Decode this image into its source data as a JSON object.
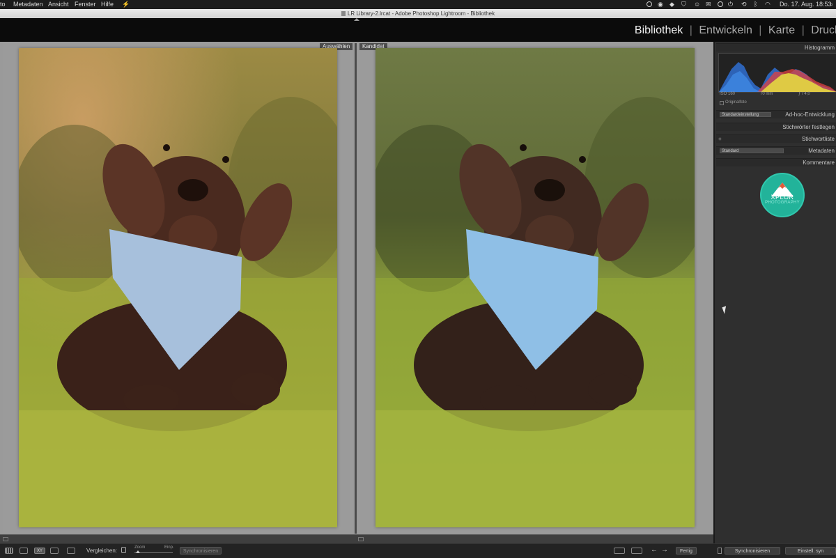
{
  "menubar": {
    "items": [
      "to",
      "Metadaten",
      "Ansicht",
      "Fenster",
      "Hilfe"
    ],
    "clock": "Do. 17. Aug.  18:53"
  },
  "window": {
    "title": "LR Library-2.lrcat - Adobe Photoshop Lightroom - Bibliothek"
  },
  "modules": {
    "library": "Bibliothek",
    "develop": "Entwickeln",
    "map": "Karte",
    "print": "Druck",
    "separator": "|"
  },
  "compare": {
    "select_label": "Auswählen",
    "candidate_label": "Kandidat"
  },
  "right_panel": {
    "histogram_header": "Histogramm",
    "histogram_info": {
      "iso": "ISO 160",
      "focal": "70 mm",
      "aperture": "ƒ / 4,0"
    },
    "original_photo_label": "Originalfoto",
    "quick_develop_preset": "Standardeinstellung",
    "quick_develop_header": "Ad-hoc-Entwicklung",
    "keywording_header": "Stichwörter festlegen",
    "keyword_list_header": "Stichwortliste",
    "keyword_list_plus": "+",
    "metadata_preset": "Standard",
    "metadata_header": "Metadaten",
    "comments_header": "Kommentare"
  },
  "logo": {
    "title": "XPLOR",
    "subtitle": "PHOTOGRAPHY"
  },
  "toolbar": {
    "compare_label": "Vergleichen:",
    "zoom_label": "Zoom",
    "zoom_value": "Einp.",
    "sync_focus_button": "Synchronisieren",
    "done_button": "Fertig",
    "sync_button": "Synchronisieren",
    "sync_settings_button": "Einstell. syn"
  },
  "colors": {
    "accent_logo": "#22b39a",
    "panel_bg": "#2f2f2f",
    "stage_bg": "#9a9a9a"
  }
}
